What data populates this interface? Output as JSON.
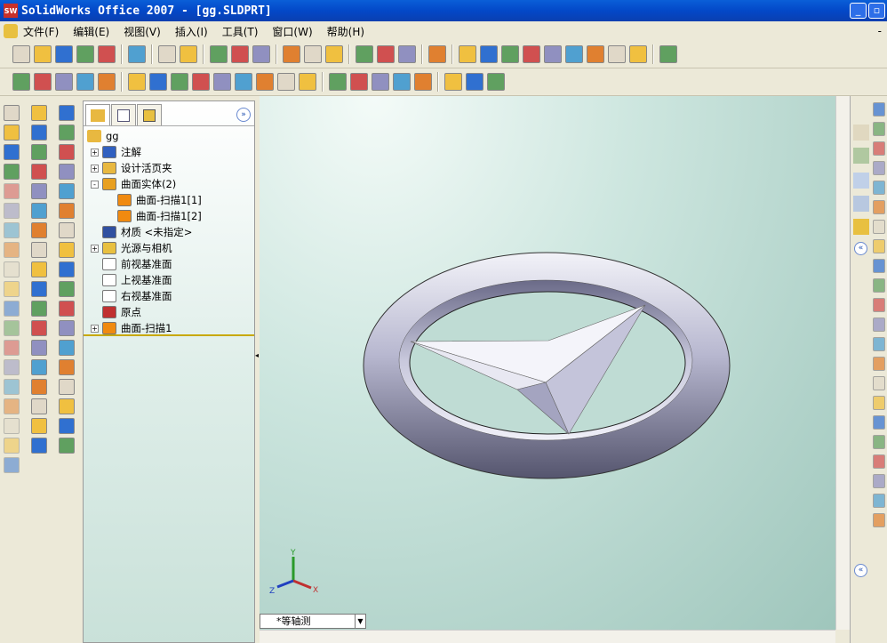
{
  "window": {
    "title": "SolidWorks Office 2007 - [gg.SLDPRT]",
    "logo": "SW"
  },
  "menu": [
    "文件(F)",
    "编辑(E)",
    "视图(V)",
    "插入(I)",
    "工具(T)",
    "窗口(W)",
    "帮助(H)"
  ],
  "toolbar1": [
    "new-icon",
    "open-icon",
    "save-icon",
    "options-icon",
    "rebuild-icon",
    "|",
    "print-icon",
    "|",
    "undo-icon",
    "redo-icon",
    "|",
    "select-icon",
    "selection-filter-icon",
    "traffic-light-icon",
    "|",
    "color-palette-icon",
    "equations-icon",
    "appearance-icon",
    "|",
    "3d-box-icon",
    "layout-icon",
    "help-icon",
    "|",
    "view-orient-icon",
    "|",
    "front-view-icon",
    "back-view-icon",
    "left-view-icon",
    "right-view-icon",
    "top-view-icon",
    "bottom-view-icon",
    "isometric-view-icon",
    "trimetric-view-icon",
    "dimetric-view-icon",
    "|",
    "pin-icon"
  ],
  "toolbar2": [
    "plane-icon",
    "axis-icon",
    "coordinate-system-icon",
    "point-icon",
    "mate-reference-icon",
    "|",
    "previous-view-icon",
    "zoom-fit-icon",
    "zoom-area-icon",
    "zoom-in-out-icon",
    "zoom-selection-icon",
    "rotate-icon",
    "pan-icon",
    "roll-icon",
    "view-orientation-icon",
    "|",
    "wireframe-icon",
    "hidden-lines-visible-icon",
    "hidden-lines-removed-icon",
    "shaded-edges-icon",
    "shaded-icon",
    "|",
    "section-view-icon",
    "curvature-icon",
    "realview-icon"
  ],
  "tree": {
    "root": "gg",
    "items": [
      {
        "label": "注解",
        "level": 1,
        "expand": "+",
        "icon": "annotation-icon",
        "color": "#3060c0"
      },
      {
        "label": "设计活页夹",
        "level": 1,
        "expand": "+",
        "icon": "design-binder-icon",
        "color": "#e8b840"
      },
      {
        "label": "曲面实体(2)",
        "level": 1,
        "expand": "-",
        "icon": "surface-bodies-folder-icon",
        "color": "#e8a020"
      },
      {
        "label": "曲面-扫描1[1]",
        "level": 2,
        "expand": "",
        "icon": "surface-body-icon",
        "color": "#f08a10"
      },
      {
        "label": "曲面-扫描1[2]",
        "level": 2,
        "expand": "",
        "icon": "surface-body-icon",
        "color": "#f08a10"
      },
      {
        "label": "材质 <未指定>",
        "level": 1,
        "expand": "",
        "icon": "material-icon",
        "color": "#3050a0"
      },
      {
        "label": "光源与相机",
        "level": 1,
        "expand": "+",
        "icon": "lights-cameras-icon",
        "color": "#e8c040"
      },
      {
        "label": "前视基准面",
        "level": 1,
        "expand": "",
        "icon": "plane-icon",
        "color": "#ffffff"
      },
      {
        "label": "上视基准面",
        "level": 1,
        "expand": "",
        "icon": "plane-icon",
        "color": "#ffffff"
      },
      {
        "label": "右视基准面",
        "level": 1,
        "expand": "",
        "icon": "plane-icon",
        "color": "#ffffff"
      },
      {
        "label": "原点",
        "level": 1,
        "expand": "",
        "icon": "origin-icon",
        "color": "#c03030"
      },
      {
        "label": "曲面-扫描1",
        "level": 1,
        "expand": "+",
        "icon": "surface-sweep-icon",
        "color": "#f08a10"
      }
    ]
  },
  "view": {
    "orientation": "*等轴测",
    "triad": {
      "x": "X",
      "y": "Y",
      "z": "Z"
    }
  }
}
